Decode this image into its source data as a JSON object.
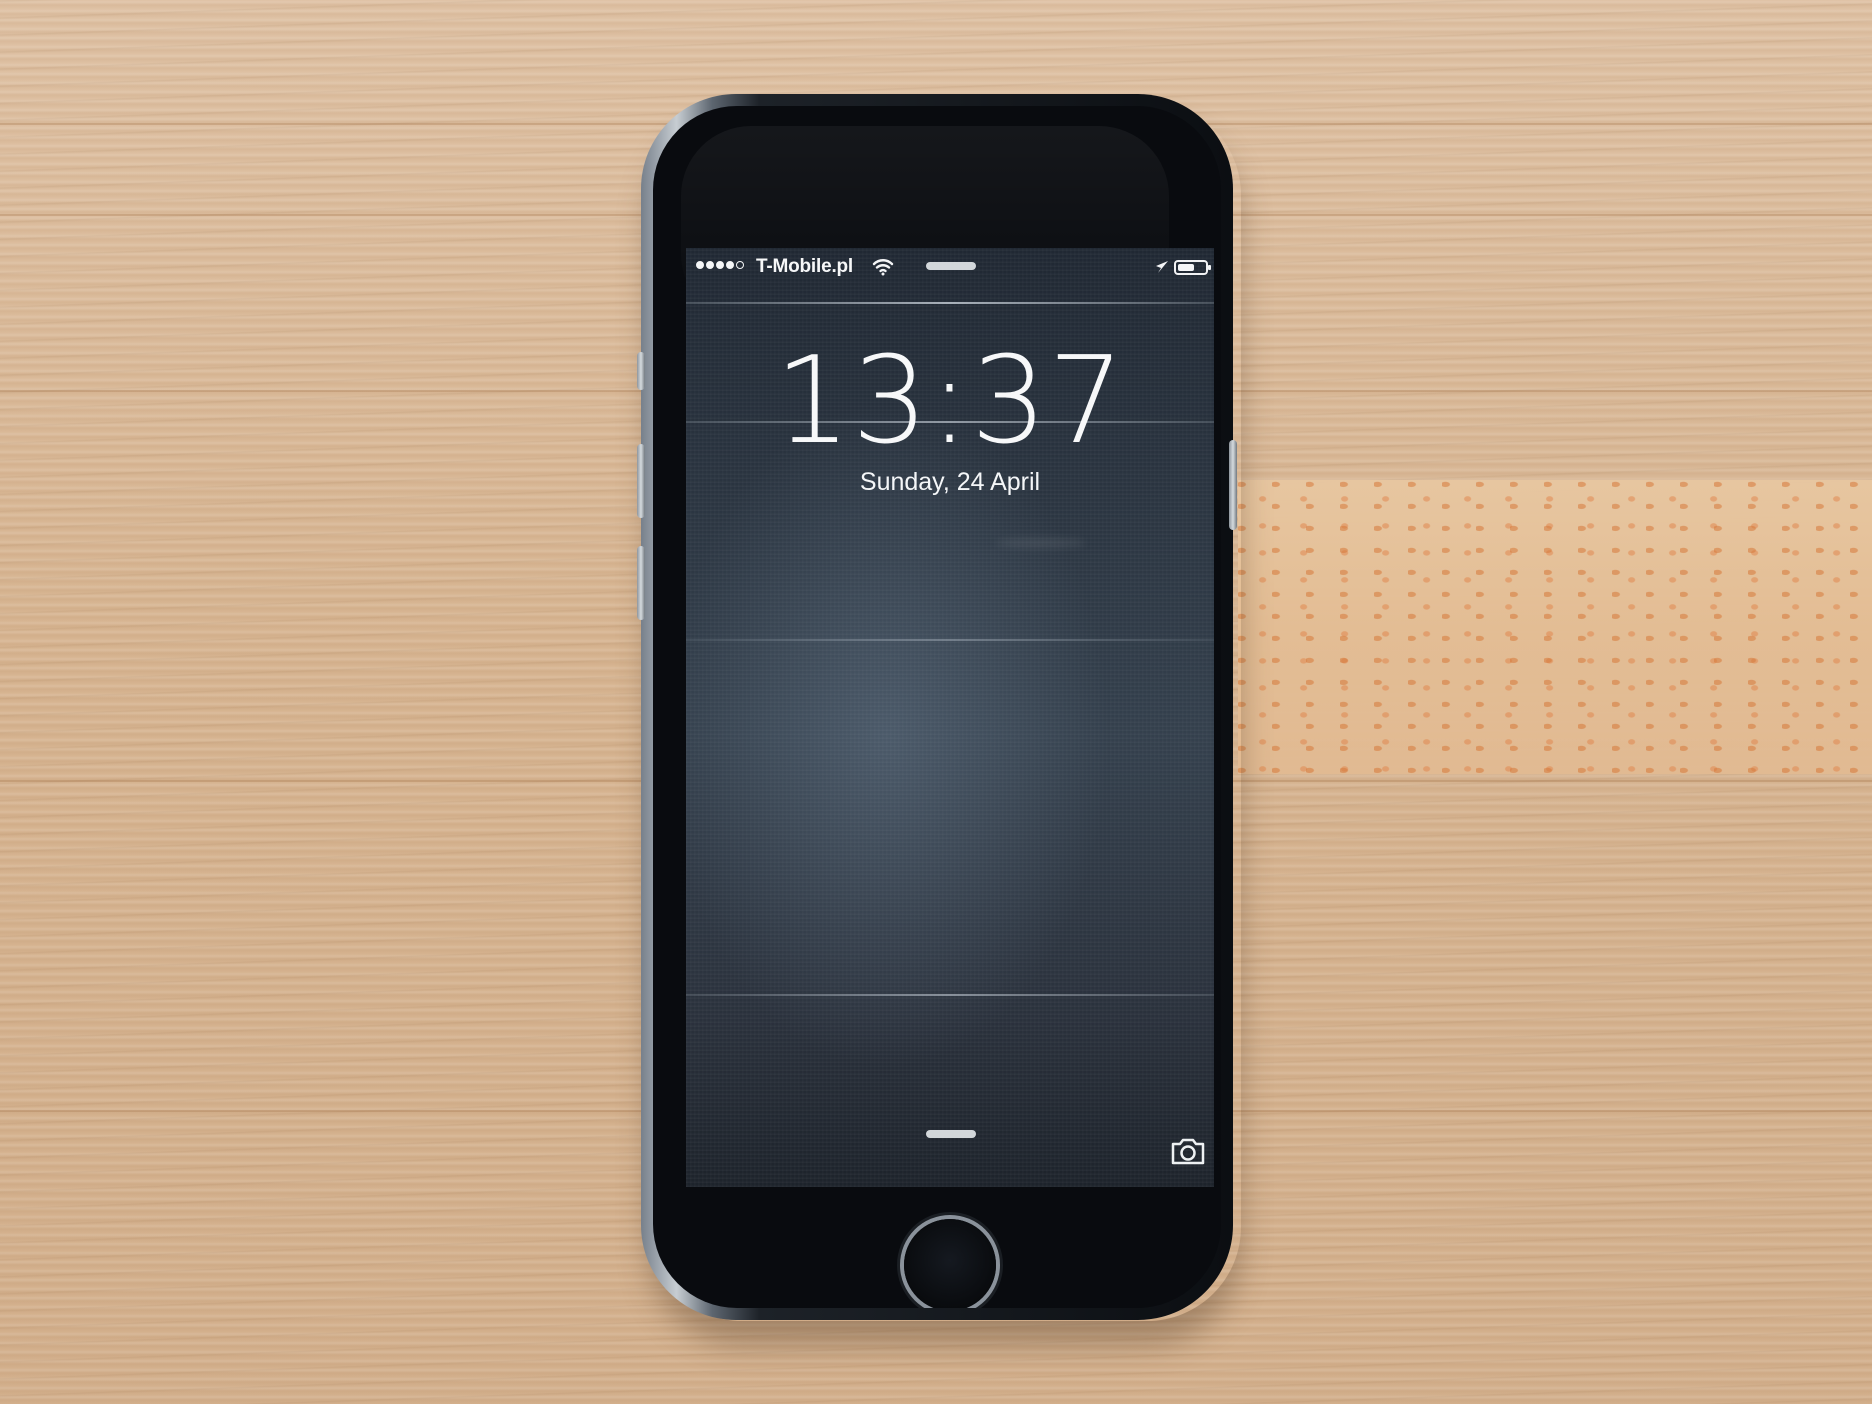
{
  "status_bar": {
    "carrier": "T-Mobile.pl"
  },
  "lock_screen": {
    "time": "13:37",
    "date": "Sunday, 24 April"
  },
  "icons": {
    "signal": "signal-dots-icon",
    "wifi": "wifi-icon",
    "location": "location-arrow-icon",
    "battery": "battery-icon",
    "camera": "camera-icon"
  },
  "colors": {
    "wood": "#d9b897",
    "phone_frame": "#7a838d",
    "phone_face": "#090b0f",
    "screen": "#2b3440",
    "text": "#f7f8f9"
  }
}
